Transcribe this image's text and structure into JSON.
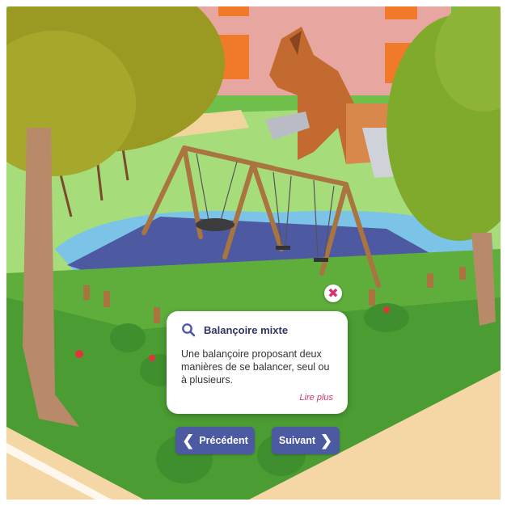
{
  "marker": {
    "close_symbol": "✖"
  },
  "info_card": {
    "icon": "search-icon",
    "title": "Balançoire mixte",
    "description": "Une balançoire proposant deux manières de se balancer, seul ou à plusieurs.",
    "read_more": "Lire plus"
  },
  "navigation": {
    "previous_label": "Précédent",
    "next_label": "Suivant",
    "previous_icon": "chevron-left-icon",
    "next_icon": "chevron-right-icon"
  },
  "colors": {
    "button": "#4b5aa1",
    "accent": "#d6336c",
    "title": "#2f3564"
  }
}
